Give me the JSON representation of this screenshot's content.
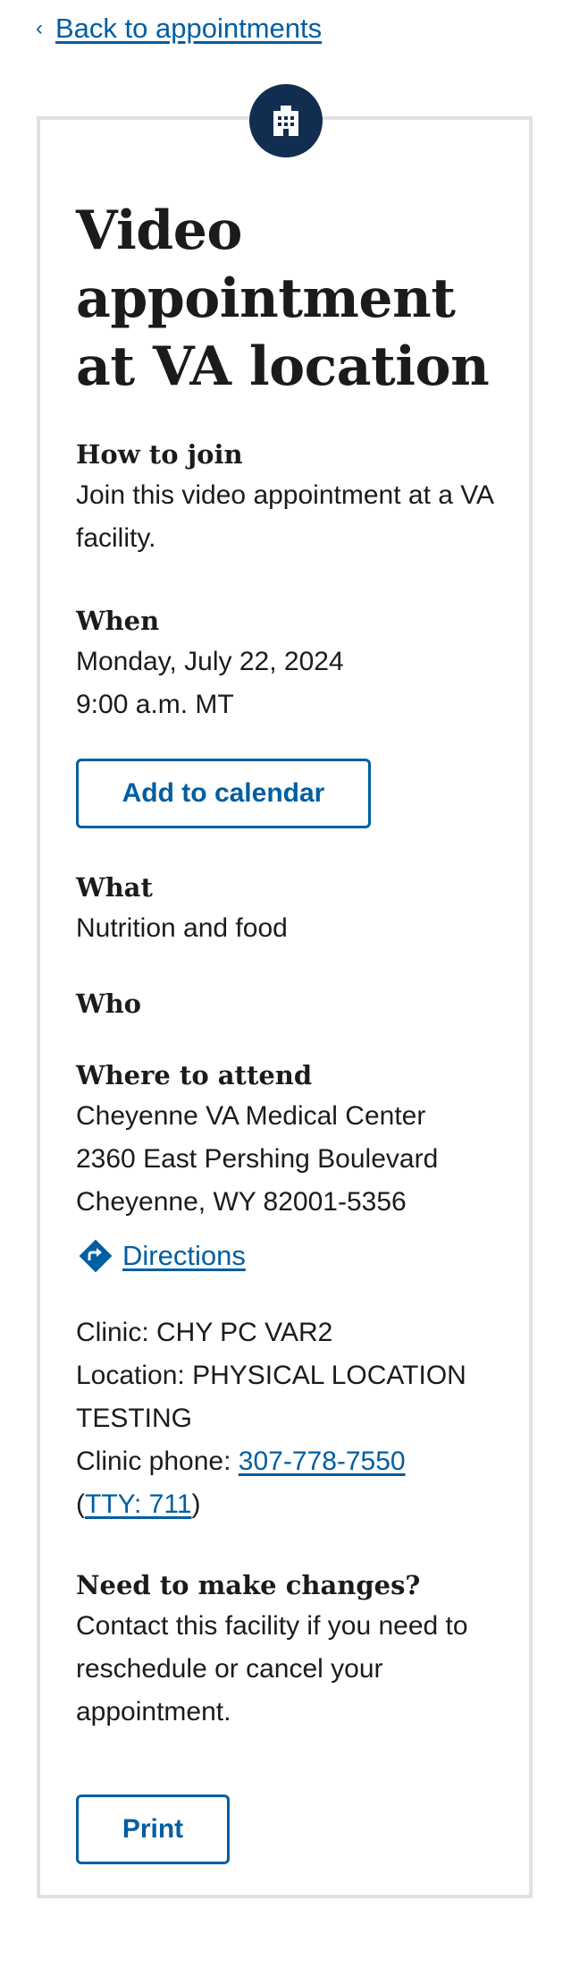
{
  "nav": {
    "back_label": "Back to appointments"
  },
  "appointment": {
    "title": "Video appointment at VA location",
    "how_to_join": {
      "heading": "How to join",
      "body": "Join this video appointment at a VA facility."
    },
    "when": {
      "heading": "When",
      "date": "Monday, July 22, 2024",
      "time": "9:00 a.m. MT",
      "calendar_button": "Add to calendar"
    },
    "what": {
      "heading": "What",
      "body": "Nutrition and food"
    },
    "who": {
      "heading": "Who"
    },
    "where": {
      "heading": "Where to attend",
      "facility": "Cheyenne VA Medical Center",
      "street": "2360 East Pershing Boulevard",
      "city_state_zip": "Cheyenne, WY 82001-5356",
      "directions_label": "Directions",
      "clinic": "Clinic: CHY PC VAR2",
      "location": "Location: PHYSICAL LOCATION TESTING",
      "phone_prefix": "Clinic phone: ",
      "phone": "307-778-7550",
      "tty_open": "(",
      "tty": "TTY: 711",
      "tty_close": ")"
    },
    "changes": {
      "heading": "Need to make changes?",
      "body": "Contact this facility if you need to reschedule or cancel your appointment."
    },
    "print_button": "Print"
  },
  "colors": {
    "link": "#005ea2",
    "badge_bg": "#112e51",
    "card_border": "#dfe1e2",
    "text": "#1b1b1b"
  },
  "icons": {
    "back": "chevron-left-icon",
    "badge": "building-icon",
    "directions": "directions-icon"
  }
}
